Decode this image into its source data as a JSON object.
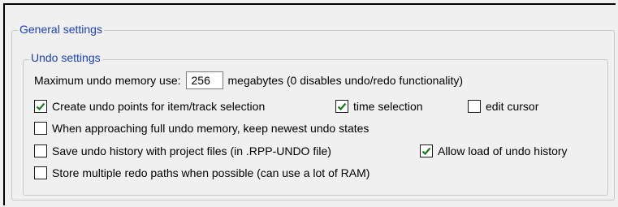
{
  "general": {
    "title": "General settings"
  },
  "undo": {
    "title": "Undo settings",
    "max_memory": {
      "label": "Maximum undo memory use:",
      "value": "256",
      "suffix": "megabytes (0 disables undo/redo functionality)"
    },
    "create_points": {
      "label": "Create undo points for item/track selection",
      "checked": true
    },
    "time_selection": {
      "label": "time selection",
      "checked": true
    },
    "edit_cursor": {
      "label": "edit cursor",
      "checked": false
    },
    "keep_newest": {
      "label": "When approaching full undo memory, keep newest undo states",
      "checked": false
    },
    "save_history": {
      "label": "Save undo history with project files (in .RPP-UNDO file)",
      "checked": false
    },
    "allow_load": {
      "label": "Allow load of undo history",
      "checked": true
    },
    "redo_paths": {
      "label": "Store multiple redo paths when possible (can use a lot of RAM)",
      "checked": false
    }
  },
  "colors": {
    "group_title": "#1a3fc0",
    "check": "#1a7a1a"
  }
}
